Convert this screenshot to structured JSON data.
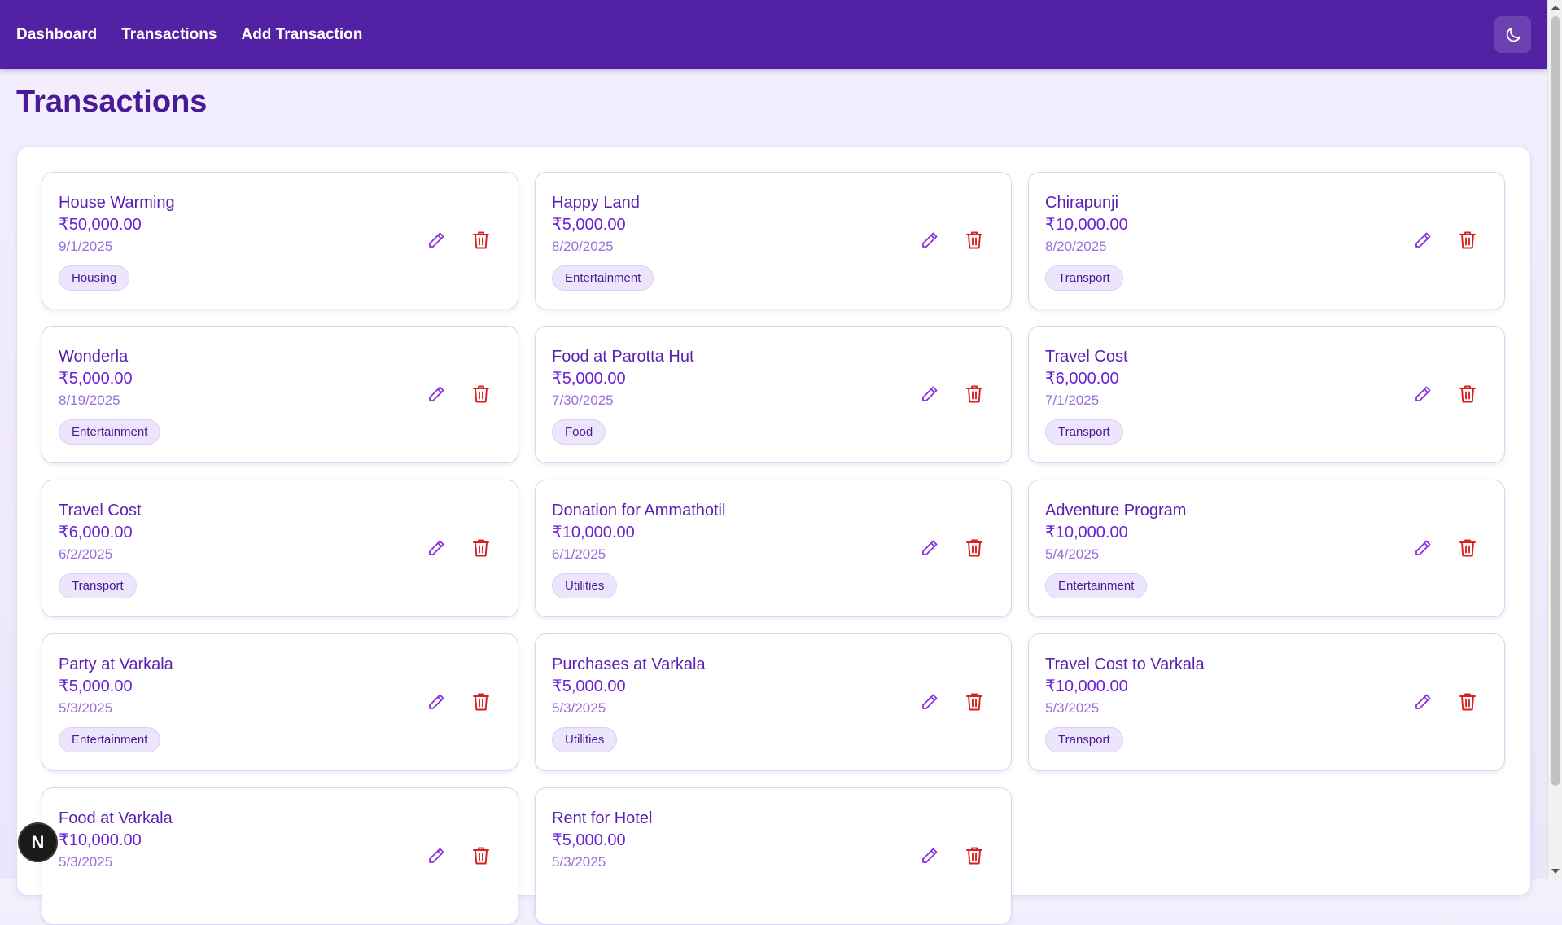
{
  "nav": {
    "links": [
      "Dashboard",
      "Transactions",
      "Add Transaction"
    ],
    "theme_icon": "moon-icon"
  },
  "page": {
    "title": "Transactions"
  },
  "colors": {
    "nav_bg": "#5321a4",
    "accent": "#6a22d6",
    "delete": "#d92020",
    "edit": "#8b2fe0"
  },
  "transactions": [
    {
      "name": "House Warming",
      "amount": "₹50,000.00",
      "date": "9/1/2025",
      "category": "Housing"
    },
    {
      "name": "Happy Land",
      "amount": "₹5,000.00",
      "date": "8/20/2025",
      "category": "Entertainment"
    },
    {
      "name": "Chirapunji",
      "amount": "₹10,000.00",
      "date": "8/20/2025",
      "category": "Transport"
    },
    {
      "name": "Wonderla",
      "amount": "₹5,000.00",
      "date": "8/19/2025",
      "category": "Entertainment"
    },
    {
      "name": "Food at Parotta Hut",
      "amount": "₹5,000.00",
      "date": "7/30/2025",
      "category": "Food"
    },
    {
      "name": "Travel Cost",
      "amount": "₹6,000.00",
      "date": "7/1/2025",
      "category": "Transport"
    },
    {
      "name": "Travel Cost",
      "amount": "₹6,000.00",
      "date": "6/2/2025",
      "category": "Transport"
    },
    {
      "name": "Donation for Ammathotil",
      "amount": "₹10,000.00",
      "date": "6/1/2025",
      "category": "Utilities"
    },
    {
      "name": "Adventure Program",
      "amount": "₹10,000.00",
      "date": "5/4/2025",
      "category": "Entertainment"
    },
    {
      "name": "Party at Varkala",
      "amount": "₹5,000.00",
      "date": "5/3/2025",
      "category": "Entertainment"
    },
    {
      "name": "Purchases at Varkala",
      "amount": "₹5,000.00",
      "date": "5/3/2025",
      "category": "Utilities"
    },
    {
      "name": "Travel Cost to Varkala",
      "amount": "₹10,000.00",
      "date": "5/3/2025",
      "category": "Transport"
    },
    {
      "name": "Food at Varkala",
      "amount": "₹10,000.00",
      "date": "5/3/2025",
      "category": ""
    },
    {
      "name": "Rent for Hotel",
      "amount": "₹5,000.00",
      "date": "5/3/2025",
      "category": ""
    }
  ],
  "dev_badge": {
    "label": "N"
  }
}
